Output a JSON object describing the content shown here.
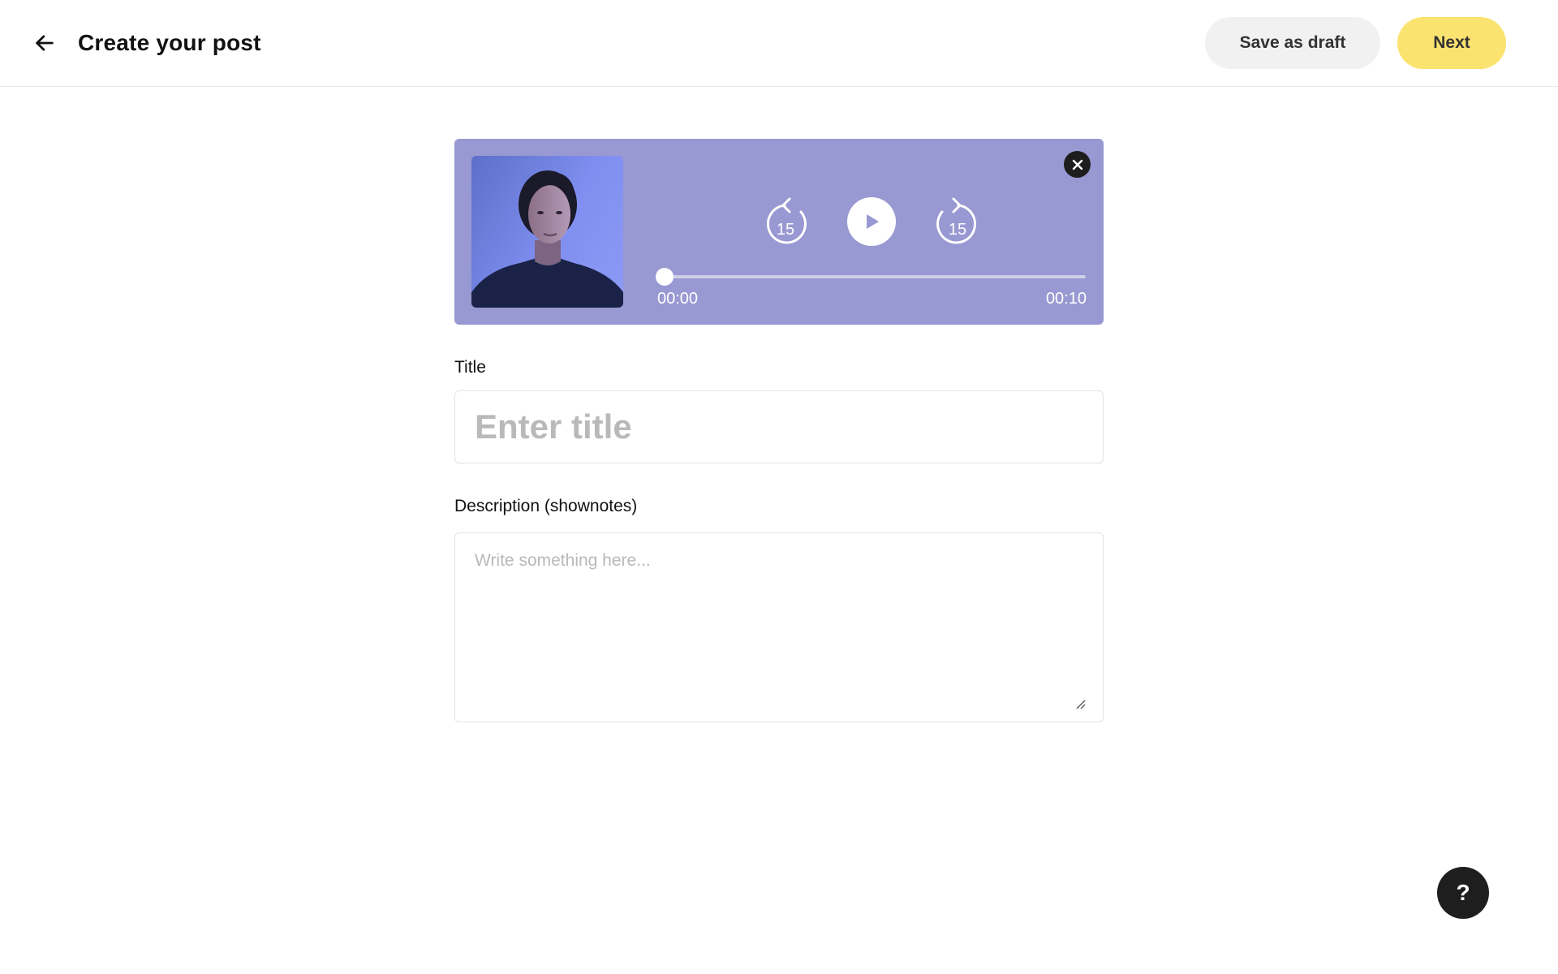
{
  "header": {
    "title": "Create your post",
    "save_draft_label": "Save as draft",
    "next_label": "Next",
    "accent_color": "#fbe36f"
  },
  "player": {
    "background_color": "#9898d2",
    "rewind_seconds": "15",
    "forward_seconds": "15",
    "current_time": "00:00",
    "duration": "00:10",
    "progress": 0
  },
  "form": {
    "title_label": "Title",
    "title_placeholder": "Enter title",
    "title_value": "",
    "description_label": "Description (shownotes)",
    "description_placeholder": "Write something here...",
    "description_value": ""
  },
  "help": {
    "label": "?"
  }
}
